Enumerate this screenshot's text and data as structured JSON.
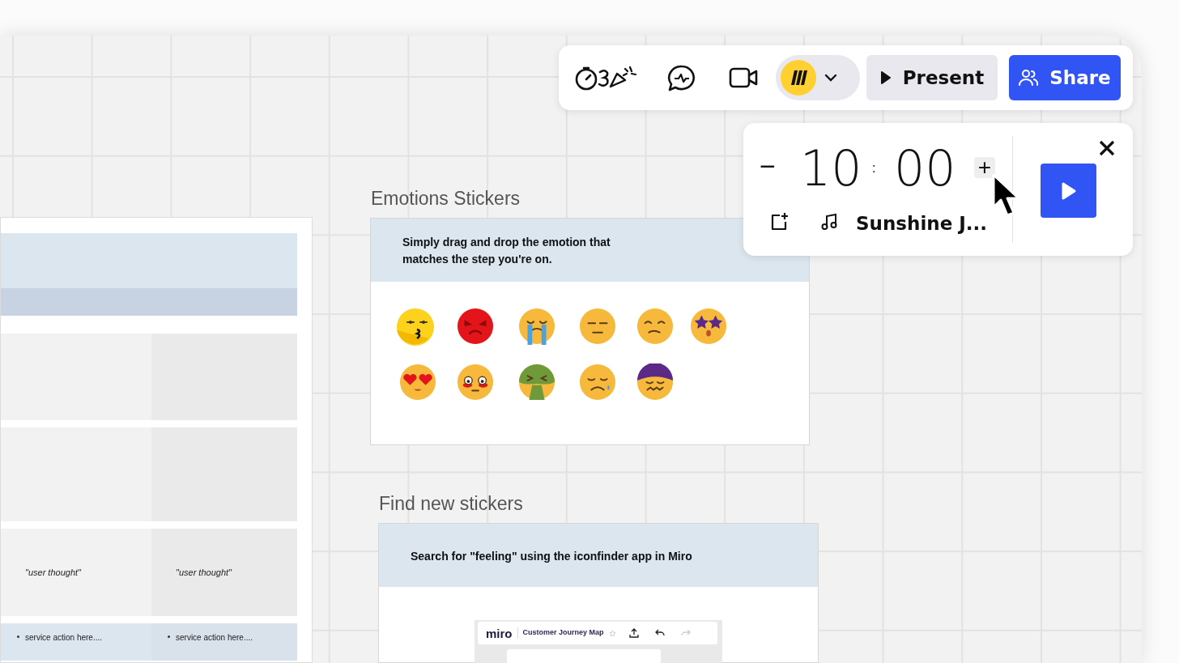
{
  "toolbar": {
    "avatar_menu_expanded": false,
    "buttons": [
      {
        "label": "Present",
        "kind": "secondary"
      },
      {
        "label": "Share",
        "kind": "primary"
      }
    ]
  },
  "timer": {
    "decrease": "−",
    "minutes": "10",
    "separator": ":",
    "seconds": "00",
    "increase": "+",
    "track": "Sunshine J..."
  },
  "journey_frame": {
    "cells": [
      {
        "kind": "thought",
        "text": "\"user thought\""
      },
      {
        "kind": "thought",
        "text": "\"user thought\""
      },
      {
        "kind": "action",
        "text": "service action here...."
      },
      {
        "kind": "action",
        "text": "service action here...."
      }
    ]
  },
  "emotions_section": {
    "title": "Emotions Stickers",
    "instruction": "Simply drag and drop the emotion that matches the step you're on."
  },
  "find_section": {
    "title": "Find new stickers",
    "instruction": "Search for \"feeling\" using the iconfinder app in Miro",
    "preview": {
      "logo": "miro",
      "board_title": "Customer Journey Map"
    }
  }
}
